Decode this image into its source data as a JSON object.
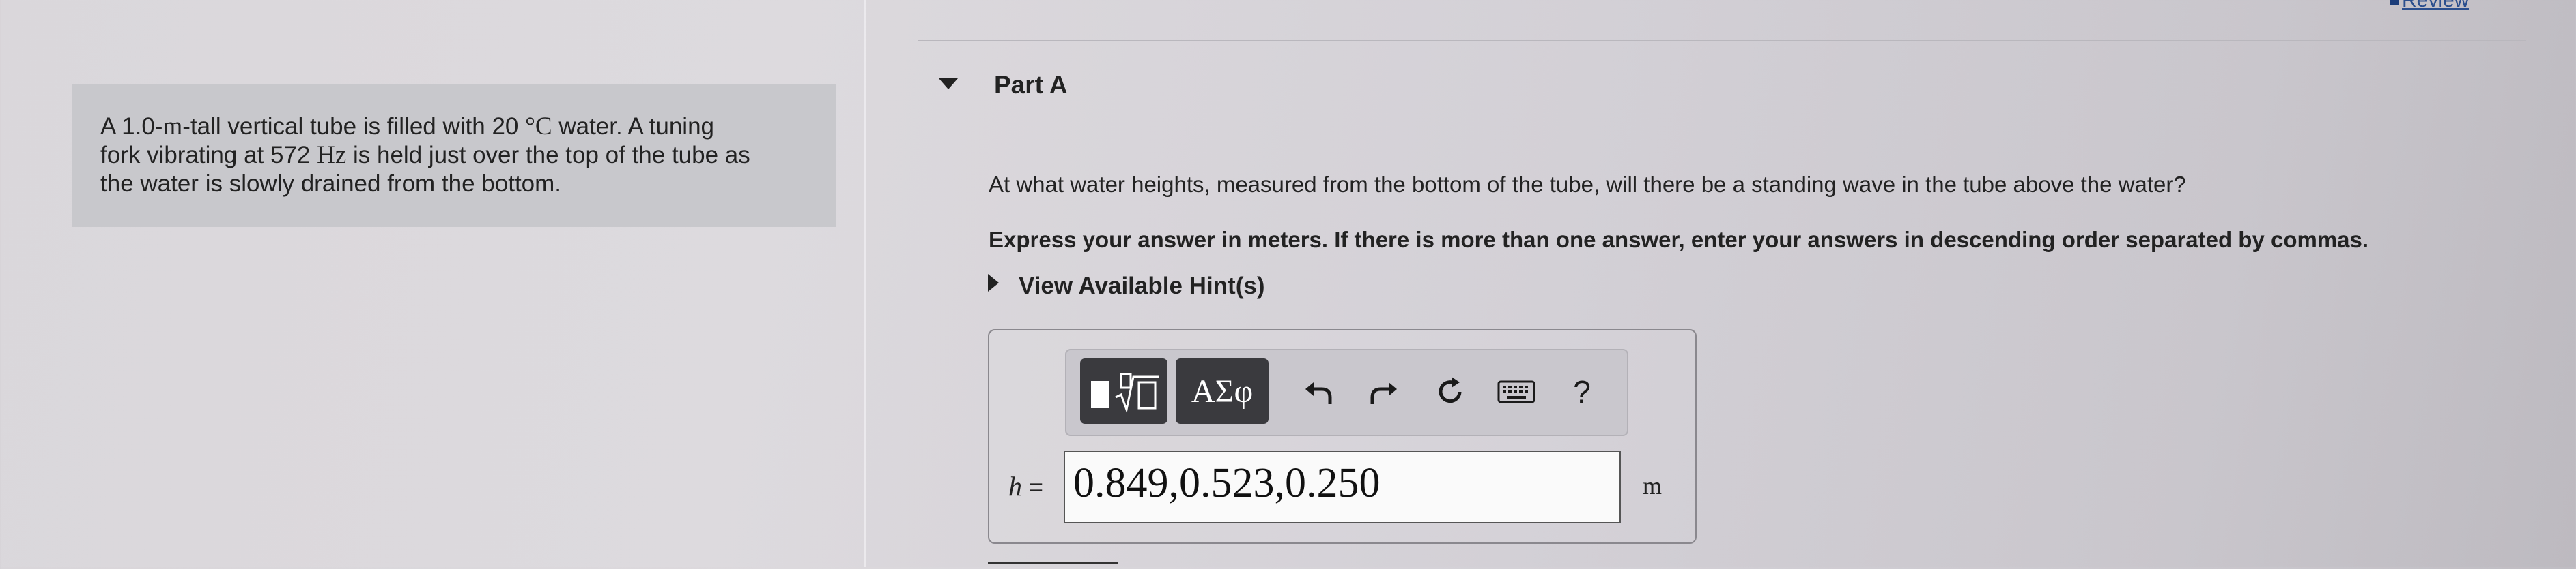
{
  "header": {
    "review_label": "Review"
  },
  "problem": {
    "line1_pre": "A 1.0-",
    "line1_unit": "m",
    "line1_mid": "-tall vertical tube is filled with 20 ",
    "line1_degC": "°C",
    "line1_post": " water. A tuning",
    "line2_pre": "fork vibrating at 572 ",
    "line2_unit": "Hz",
    "line2_post": " is held just over the top of the tube as",
    "line3": "the water is slowly drained from the bottom."
  },
  "part": {
    "title": "Part A",
    "question": "At what water heights, measured from the bottom of the tube, will there be a standing wave in the tube above the water?",
    "instruction": "Express your answer in meters. If there is more than one answer, enter your answers in descending order separated by commas.",
    "hints_label": "View Available Hint(s)"
  },
  "toolbar": {
    "templates_icon": "template-radical-icon",
    "greek_label": "ΑΣφ",
    "undo_icon": "undo-icon",
    "redo_icon": "redo-icon",
    "reset_icon": "reset-icon",
    "keyboard_icon": "keyboard-icon",
    "help_label": "?"
  },
  "answer": {
    "variable": "h",
    "equals": "=",
    "value": "0.849,0.523,0.250",
    "unit": "m"
  }
}
